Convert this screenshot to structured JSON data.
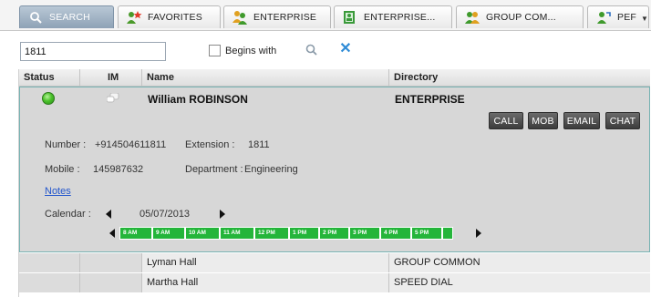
{
  "tabs": [
    {
      "label": "SEARCH",
      "icon": "search-icon",
      "active": true
    },
    {
      "label": "FAVORITES",
      "icon": "favorites-icon",
      "active": false
    },
    {
      "label": "ENTERPRISE",
      "icon": "enterprise-icon",
      "active": false
    },
    {
      "label": "ENTERPRISE...",
      "icon": "enterprise-directory-icon",
      "active": false
    },
    {
      "label": "GROUP COM...",
      "icon": "group-common-icon",
      "active": false
    },
    {
      "label": "PEF",
      "icon": "personal-icon",
      "active": false
    }
  ],
  "search": {
    "value": "1811",
    "begins_with_label": "Begins with",
    "begins_with_checked": false
  },
  "table": {
    "headers": {
      "status": "Status",
      "im": "IM",
      "name": "Name",
      "directory": "Directory"
    }
  },
  "expanded": {
    "name": "William ROBINSON",
    "directory": "ENTERPRISE",
    "status_color": "#4cc22c",
    "actions": [
      "CALL",
      "MOB",
      "EMAIL",
      "CHAT"
    ],
    "number_label": "Number :",
    "number": "+914504611811",
    "extension_label": "Extension :",
    "extension": "1811",
    "mobile_label": "Mobile :",
    "mobile": "145987632",
    "department_label": "Department :",
    "department": "Engineering",
    "notes": "Notes",
    "calendar_label": "Calendar :",
    "calendar_date": "05/07/2013",
    "timeline_color": "#24b53a",
    "timeline": [
      "8 AM",
      "9 AM",
      "10 AM",
      "11 AM",
      "12 PM",
      "1 PM",
      "2 PM",
      "3 PM",
      "4 PM",
      "5 PM",
      ""
    ]
  },
  "rows": [
    {
      "name": "Lyman Hall",
      "directory": "GROUP COMMON"
    },
    {
      "name": "Martha Hall",
      "directory": "SPEED DIAL"
    }
  ]
}
